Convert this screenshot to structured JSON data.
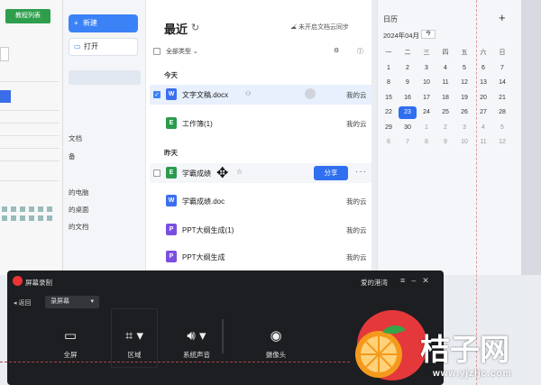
{
  "left_panel": {
    "button_label": "教程列表"
  },
  "wps_sidebar": {
    "new_label": "新建",
    "open_label": "打开",
    "items": [
      "文档",
      "备",
      "的电脑",
      "的桌面",
      "的文档"
    ]
  },
  "main": {
    "title": "最近",
    "sync_text": "未开启文档云同步",
    "filter_label": "全部类型",
    "sections": {
      "today": "今天",
      "yesterday": "昨天"
    },
    "files": [
      {
        "name": "文字文稿.docx",
        "type": "w",
        "location": "我的云"
      },
      {
        "name": "工作簿(1)",
        "type": "e",
        "location": "我的云"
      },
      {
        "name": "学霸成绩",
        "type": "e",
        "location": "",
        "share_label": "分享"
      },
      {
        "name": "学霸成绩.doc",
        "type": "w",
        "location": "我的云"
      },
      {
        "name": "PPT大纲生成(1)",
        "type": "p",
        "location": "我的云"
      },
      {
        "name": "PPT大纲生成",
        "type": "p",
        "location": "我的云"
      }
    ]
  },
  "calendar": {
    "title": "日历",
    "month_label": "2024年04月",
    "today_button": "今",
    "weekdays": [
      "一",
      "二",
      "三",
      "四",
      "五",
      "六",
      "日"
    ],
    "weeks": [
      [
        "1",
        "2",
        "3",
        "4",
        "5",
        "6",
        "7"
      ],
      [
        "8",
        "9",
        "10",
        "11",
        "12",
        "13",
        "14"
      ],
      [
        "15",
        "16",
        "17",
        "18",
        "19",
        "20",
        "21"
      ],
      [
        "22",
        "23",
        "24",
        "25",
        "26",
        "27",
        "28"
      ],
      [
        "29",
        "30",
        "1",
        "2",
        "3",
        "4",
        "5"
      ],
      [
        "6",
        "7",
        "8",
        "9",
        "10",
        "11",
        "12"
      ]
    ],
    "today": "23"
  },
  "recorder": {
    "title": "屏幕录制",
    "user": "爱的港湾",
    "back_label": "返回",
    "mode_label": "录屏幕",
    "tools": [
      {
        "label": "全屏",
        "icon": "monitor-icon"
      },
      {
        "label": "区域",
        "icon": "crop-icon"
      },
      {
        "label": "系统声音",
        "icon": "speaker-icon"
      },
      {
        "label": "摄像头",
        "icon": "camera-icon"
      }
    ]
  },
  "watermark": {
    "text": "桔子网",
    "url": "www.yjzljc.com"
  }
}
